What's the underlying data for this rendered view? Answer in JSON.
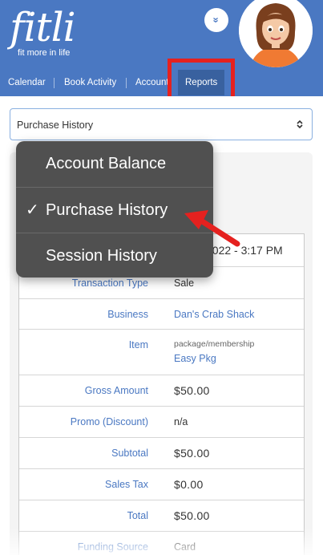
{
  "app": {
    "logo": "fitli",
    "tagline": "fit more in life",
    "collapse_glyph": "»"
  },
  "nav": {
    "items": [
      {
        "label": "Calendar"
      },
      {
        "label": "Book Activity"
      },
      {
        "label": "Account"
      },
      {
        "label": "Reports"
      }
    ],
    "active": "Reports"
  },
  "report_select": {
    "value": "Purchase History",
    "caret": "⌃⌄",
    "options": [
      {
        "label": "Account Balance",
        "checked": false
      },
      {
        "label": "Purchase History",
        "checked": true
      },
      {
        "label": "Session History",
        "checked": false
      }
    ],
    "check_glyph": "✓"
  },
  "transaction": {
    "date_partial": "2022 - 3:17 PM",
    "rows": [
      {
        "label": "Transaction Type",
        "value": "Sale"
      },
      {
        "label": "Business",
        "value": "Dan's Crab Shack"
      },
      {
        "label": "Item",
        "sub": "package/membership",
        "value": "Easy Pkg"
      },
      {
        "label": "Gross Amount",
        "value": "$50.00"
      },
      {
        "label": "Promo (Discount)",
        "value": "n/a"
      },
      {
        "label": "Subtotal",
        "value": "$50.00"
      },
      {
        "label": "Sales Tax",
        "value": "$0.00"
      },
      {
        "label": "Total",
        "value": "$50.00"
      },
      {
        "label": "Funding Source",
        "value": "Card"
      }
    ]
  },
  "colors": {
    "brand_blue": "#4a78c2",
    "active_tab": "#39619f",
    "annotation_red": "#e5211f",
    "menu_bg": "#505050"
  },
  "icons": {
    "collapse": "double-chevron-down-icon",
    "select_caret": "up-down-chevron-icon",
    "check": "checkmark-icon"
  }
}
